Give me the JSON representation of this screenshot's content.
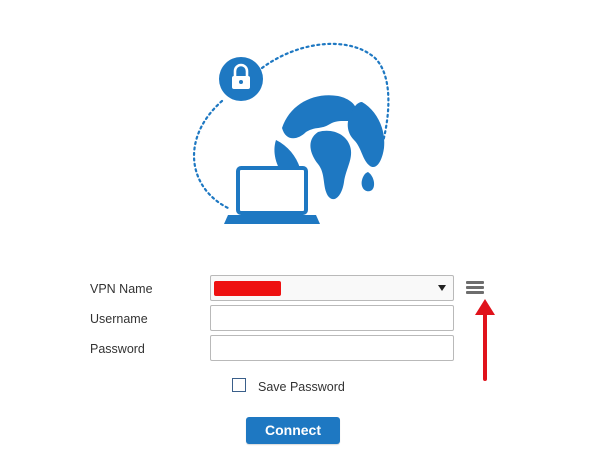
{
  "form": {
    "vpn_name_label": "VPN Name",
    "username_label": "Username",
    "password_label": "Password",
    "vpn_name_value": "",
    "username_value": "",
    "password_value": "",
    "save_password_label": "Save Password",
    "save_password_checked": false,
    "connect_label": "Connect"
  },
  "icons": {
    "lock": "lock-icon",
    "globe": "globe-icon",
    "laptop": "laptop-icon",
    "menu": "menu-icon",
    "dropdown": "chevron-down-icon"
  },
  "colors": {
    "brand_blue": "#1e78c2",
    "redaction": "#ee1111",
    "annotation_red": "#e0121b",
    "menu_gray": "#6d6d6d"
  }
}
